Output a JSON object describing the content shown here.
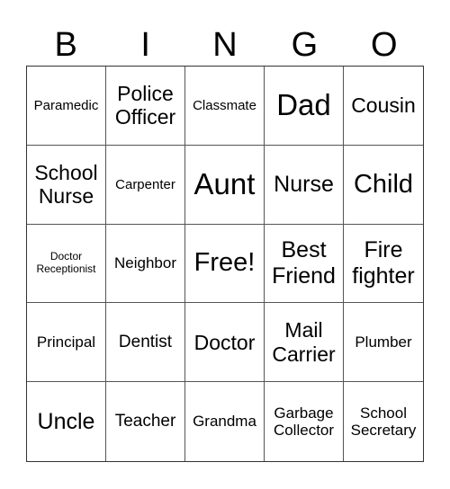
{
  "header": [
    "B",
    "I",
    "N",
    "G",
    "O"
  ],
  "cells": [
    {
      "text": "Paramedic",
      "size": "s14"
    },
    {
      "text": "Police\nOfficer",
      "size": "s22"
    },
    {
      "text": "Classmate",
      "size": "s14"
    },
    {
      "text": "Dad",
      "size": "s33"
    },
    {
      "text": "Cousin",
      "size": "s22"
    },
    {
      "text": "School\nNurse",
      "size": "s22"
    },
    {
      "text": "Carpenter",
      "size": "s14"
    },
    {
      "text": "Aunt",
      "size": "s33"
    },
    {
      "text": "Nurse",
      "size": "s25"
    },
    {
      "text": "Child",
      "size": "s28"
    },
    {
      "text": "Doctor\nReceptionist",
      "size": "s12"
    },
    {
      "text": "Neighbor",
      "size": "s17"
    },
    {
      "text": "Free!",
      "size": "s28"
    },
    {
      "text": "Best\nFriend",
      "size": "s25"
    },
    {
      "text": "Fire\nfighter",
      "size": "s25"
    },
    {
      "text": "Principal",
      "size": "s17"
    },
    {
      "text": "Dentist",
      "size": "s19"
    },
    {
      "text": "Doctor",
      "size": "s22"
    },
    {
      "text": "Mail\nCarrier",
      "size": "s22"
    },
    {
      "text": "Plumber",
      "size": "s17"
    },
    {
      "text": "Uncle",
      "size": "s25"
    },
    {
      "text": "Teacher",
      "size": "s19"
    },
    {
      "text": "Grandma",
      "size": "s17"
    },
    {
      "text": "Garbage\nCollector",
      "size": "s17"
    },
    {
      "text": "School\nSecretary",
      "size": "s17"
    }
  ]
}
